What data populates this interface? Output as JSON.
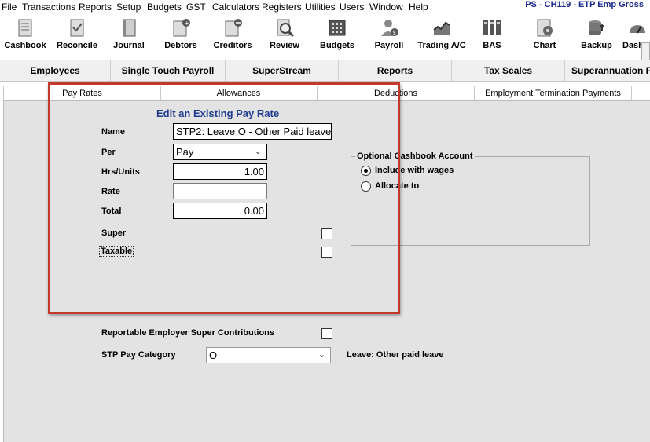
{
  "menu": [
    "File",
    "Transactions",
    "Reports",
    "Setup",
    "Budgets",
    "GST",
    "Calculators",
    "Registers",
    "Utilities",
    "Users",
    "Window",
    "Help"
  ],
  "window_title": "PS - CH119 - ETP Emp Gross",
  "toolbar": [
    {
      "label": "Cashbook",
      "icon": "cashbook-icon"
    },
    {
      "label": "Reconcile",
      "icon": "reconcile-icon"
    },
    {
      "label": "Journal",
      "icon": "journal-icon"
    },
    {
      "label": "Debtors",
      "icon": "debtors-icon"
    },
    {
      "label": "Creditors",
      "icon": "creditors-icon"
    },
    {
      "label": "Review",
      "icon": "review-icon"
    },
    {
      "label": "Budgets",
      "icon": "budgets-icon"
    },
    {
      "label": "Payroll",
      "icon": "payroll-icon"
    },
    {
      "label": "Trading A/C",
      "icon": "trading-icon"
    },
    {
      "label": "BAS",
      "icon": "bas-icon"
    },
    {
      "label": "Chart",
      "icon": "chart-icon"
    },
    {
      "label": "Backup",
      "icon": "backup-icon"
    },
    {
      "label": "Dashb",
      "icon": "dashboard-icon"
    }
  ],
  "module_tabs": [
    "Employees",
    "Single Touch Payroll",
    "SuperStream",
    "Reports",
    "Tax Scales",
    "Superannuation Fu"
  ],
  "sub_tabs": [
    "Pay Rates",
    "Allowances",
    "Deductions",
    "Employment Termination Payments"
  ],
  "form": {
    "heading": "Edit an Existing Pay Rate",
    "name_label": "Name",
    "name_value": "STP2: Leave O - Other Paid leave",
    "per_label": "Per",
    "per_value": "Pay",
    "hrs_label": "Hrs/Units",
    "hrs_value": "1.00",
    "rate_label": "Rate",
    "rate_value": "",
    "total_label": "Total",
    "total_value": "0.00",
    "super_label": "Super",
    "taxable_label": "Taxable",
    "resc_label": "Reportable Employer Super Contributions",
    "stp_label": "STP Pay Category",
    "stp_value": "O",
    "stp_desc": "Leave: Other paid leave"
  },
  "cashbook_account": {
    "title": "Optional Cashbook Account",
    "option_wages": "Include with wages",
    "option_allocate": "Allocate to",
    "selected": "Include with wages"
  }
}
